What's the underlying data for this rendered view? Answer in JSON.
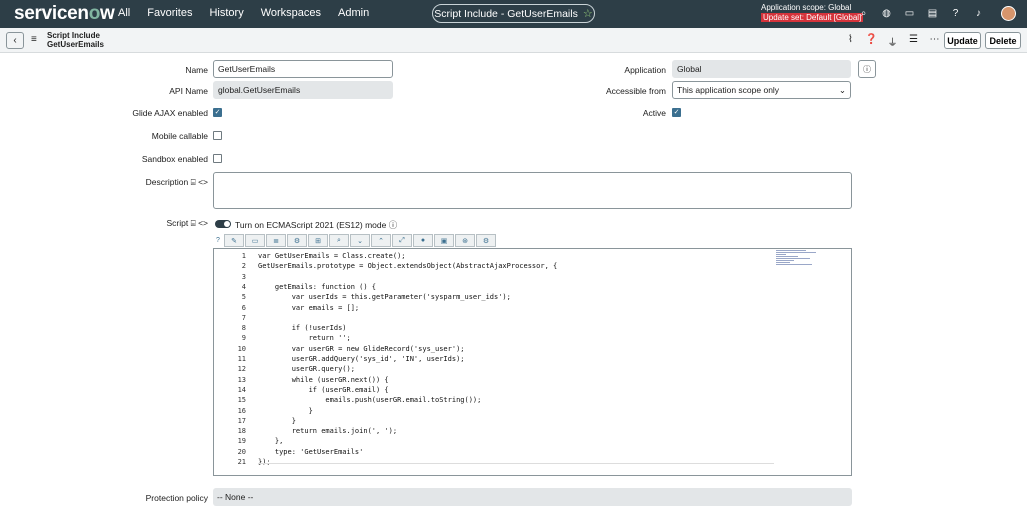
{
  "nav": {
    "logo": "servicenow",
    "menu": [
      "All",
      "Favorites",
      "History",
      "Workspaces",
      "Admin"
    ],
    "pill_title": "Script Include - GetUserEmails",
    "scope_line": "Application scope: Global",
    "update_set": "Update set: Default [Global]"
  },
  "header": {
    "title_line1": "Script Include",
    "title_line2": "GetUserEmails",
    "update_label": "Update",
    "delete_label": "Delete"
  },
  "form": {
    "name_label": "Name",
    "name_value": "GetUserEmails",
    "api_label": "API Name",
    "api_value": "global.GetUserEmails",
    "glide_label": "Glide AJAX enabled",
    "glide_checked": true,
    "mobile_label": "Mobile callable",
    "mobile_checked": false,
    "sandbox_label": "Sandbox enabled",
    "sandbox_checked": false,
    "description_label": "Description",
    "application_label": "Application",
    "application_value": "Global",
    "accessible_label": "Accessible from",
    "accessible_value": "This application scope only",
    "active_label": "Active",
    "active_checked": true,
    "script_label": "Script",
    "es12_label": "Turn on ECMAScript 2021 (ES12) mode",
    "protection_label": "Protection policy",
    "protection_value": "-- None --"
  },
  "code_lines": [
    "var GetUserEmails = Class.create();",
    "GetUserEmails.prototype = Object.extendsObject(AbstractAjaxProcessor, {",
    "",
    "    getEmails: function () {",
    "        var userIds = this.getParameter('sysparm_user_ids');",
    "        var emails = [];",
    "",
    "        if (!userIds)",
    "            return '';",
    "        var userGR = new GlideRecord('sys_user');",
    "        userGR.addQuery('sys_id', 'IN', userIds);",
    "        userGR.query();",
    "        while (userGR.next()) {",
    "            if (userGR.email) {",
    "                emails.push(userGR.email.toString());",
    "            }",
    "        }",
    "        return emails.join(', ');",
    "    },",
    "    type: 'GetUserEmails'",
    "});"
  ],
  "icons": {
    "search": "search-icon",
    "globe": "globe-icon",
    "chat": "chat-icon",
    "help": "help-icon",
    "bell": "bell-icon"
  }
}
